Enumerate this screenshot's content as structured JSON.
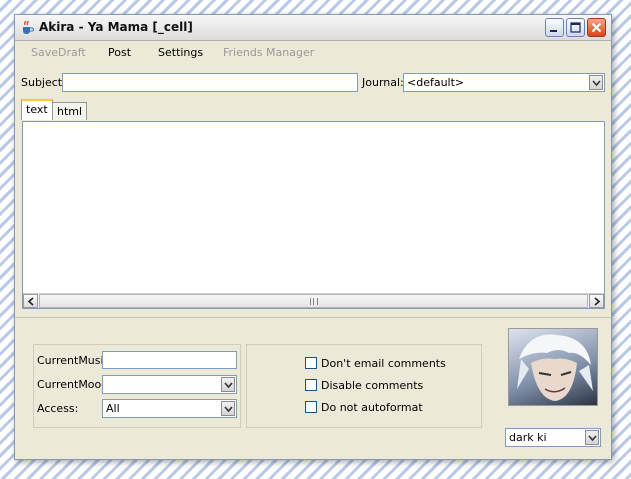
{
  "window": {
    "title": "Akira - Ya Mama [_cell]"
  },
  "menu": [
    {
      "label": "SaveDraft",
      "enabled": false
    },
    {
      "label": "Post",
      "enabled": true
    },
    {
      "label": "Settings",
      "enabled": true
    },
    {
      "label": "Friends Manager",
      "enabled": false
    }
  ],
  "header": {
    "subject_label": "Subject:",
    "subject_value": "",
    "journal_label": "Journal:",
    "journal_value": "<default>"
  },
  "tabs": [
    {
      "label": "text",
      "active": true
    },
    {
      "label": "html",
      "active": false
    }
  ],
  "meta": {
    "music_label": "CurrentMusic:",
    "music_value": "",
    "mood_label": "CurrentMood:",
    "mood_value": "",
    "access_label": "Access:",
    "access_value": "All"
  },
  "options": [
    {
      "label": "Don't email comments",
      "checked": false
    },
    {
      "label": "Disable comments",
      "checked": false
    },
    {
      "label": "Do not autoformat",
      "checked": false
    }
  ],
  "userpic": {
    "selected": "dark ki"
  },
  "icons": {
    "app": "java-cup-icon",
    "minimize": "minimize-icon",
    "maximize": "maximize-icon",
    "close": "close-icon",
    "dropdown": "chevron-down-icon"
  }
}
